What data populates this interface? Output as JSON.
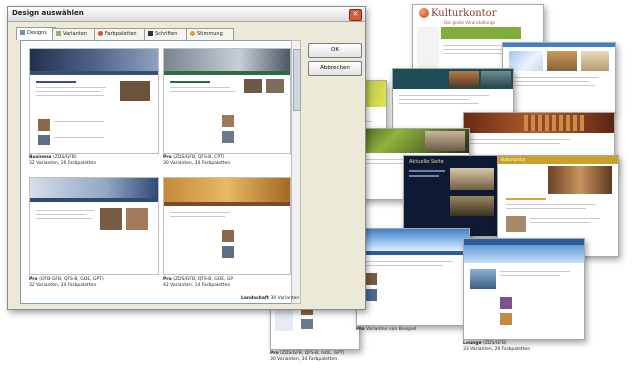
{
  "dialog": {
    "title": "Design auswählen",
    "close_glyph": "✕",
    "tabs": [
      {
        "label": "Designs",
        "icon": "palette-icon"
      },
      {
        "label": "Varianten",
        "icon": "grid-icon"
      },
      {
        "label": "Farbpaletten",
        "icon": "color-palette-icon"
      },
      {
        "label": "Schriften",
        "icon": "font-icon"
      },
      {
        "label": "Stimmung",
        "icon": "mood-icon"
      }
    ],
    "ok_label": "OK",
    "cancel_label": "Abbrechen",
    "templates": [
      {
        "name": "Business",
        "meta": "(ZDS/GFB)",
        "details": "32 Varianten, 16 Farbpaletten"
      },
      {
        "name": "Pro",
        "meta": "(ZDS/GFB, QFS-B, CPT)",
        "details": "30 Varianten, 34 Farbpaletten"
      },
      {
        "name": "Pro",
        "meta": "(QFB-GFB, QFS-B, GOE, GPT)",
        "details": "32 Varianten, 34 Farbpaletten"
      },
      {
        "name": "Pro",
        "meta": "(ZDS/GFB, QFS-B, GOE, GP",
        "details": "42 Varianten, 14 Farbpaletten"
      }
    ]
  },
  "floating": {
    "kulturkontor_title": "Kulturkontor",
    "kulturkontor_tagline": "Der große Veranstaltungs",
    "dark_page_heading": "Aktuelle Seite",
    "kulturkontor_bar": "Kulturkontor",
    "bottom_caption_1_name": "Pro",
    "bottom_caption_1_meta": "(ZDS/GFB, QFS-B, GOE, GPT)",
    "bottom_caption_1_details": "30 Varianten, 34 Farbpaletten",
    "mid_caption_name": "Pro",
    "mid_caption_details": "Varianten von Beispiel",
    "right_caption_name": "Lounge",
    "right_caption_meta": "(ZDS/GFB)",
    "right_caption_details": "33 Varianten, 20 Farbpaletten",
    "left_caption_name": "Landschaft",
    "left_caption_details": "30 Varianten"
  },
  "colors": {
    "accent_red": "#d9583b",
    "navy": "#1d3a6b",
    "gold": "#c9a227",
    "olive": "#b9b934",
    "sky": "#3f7fc8",
    "brown": "#7b4a2a"
  }
}
